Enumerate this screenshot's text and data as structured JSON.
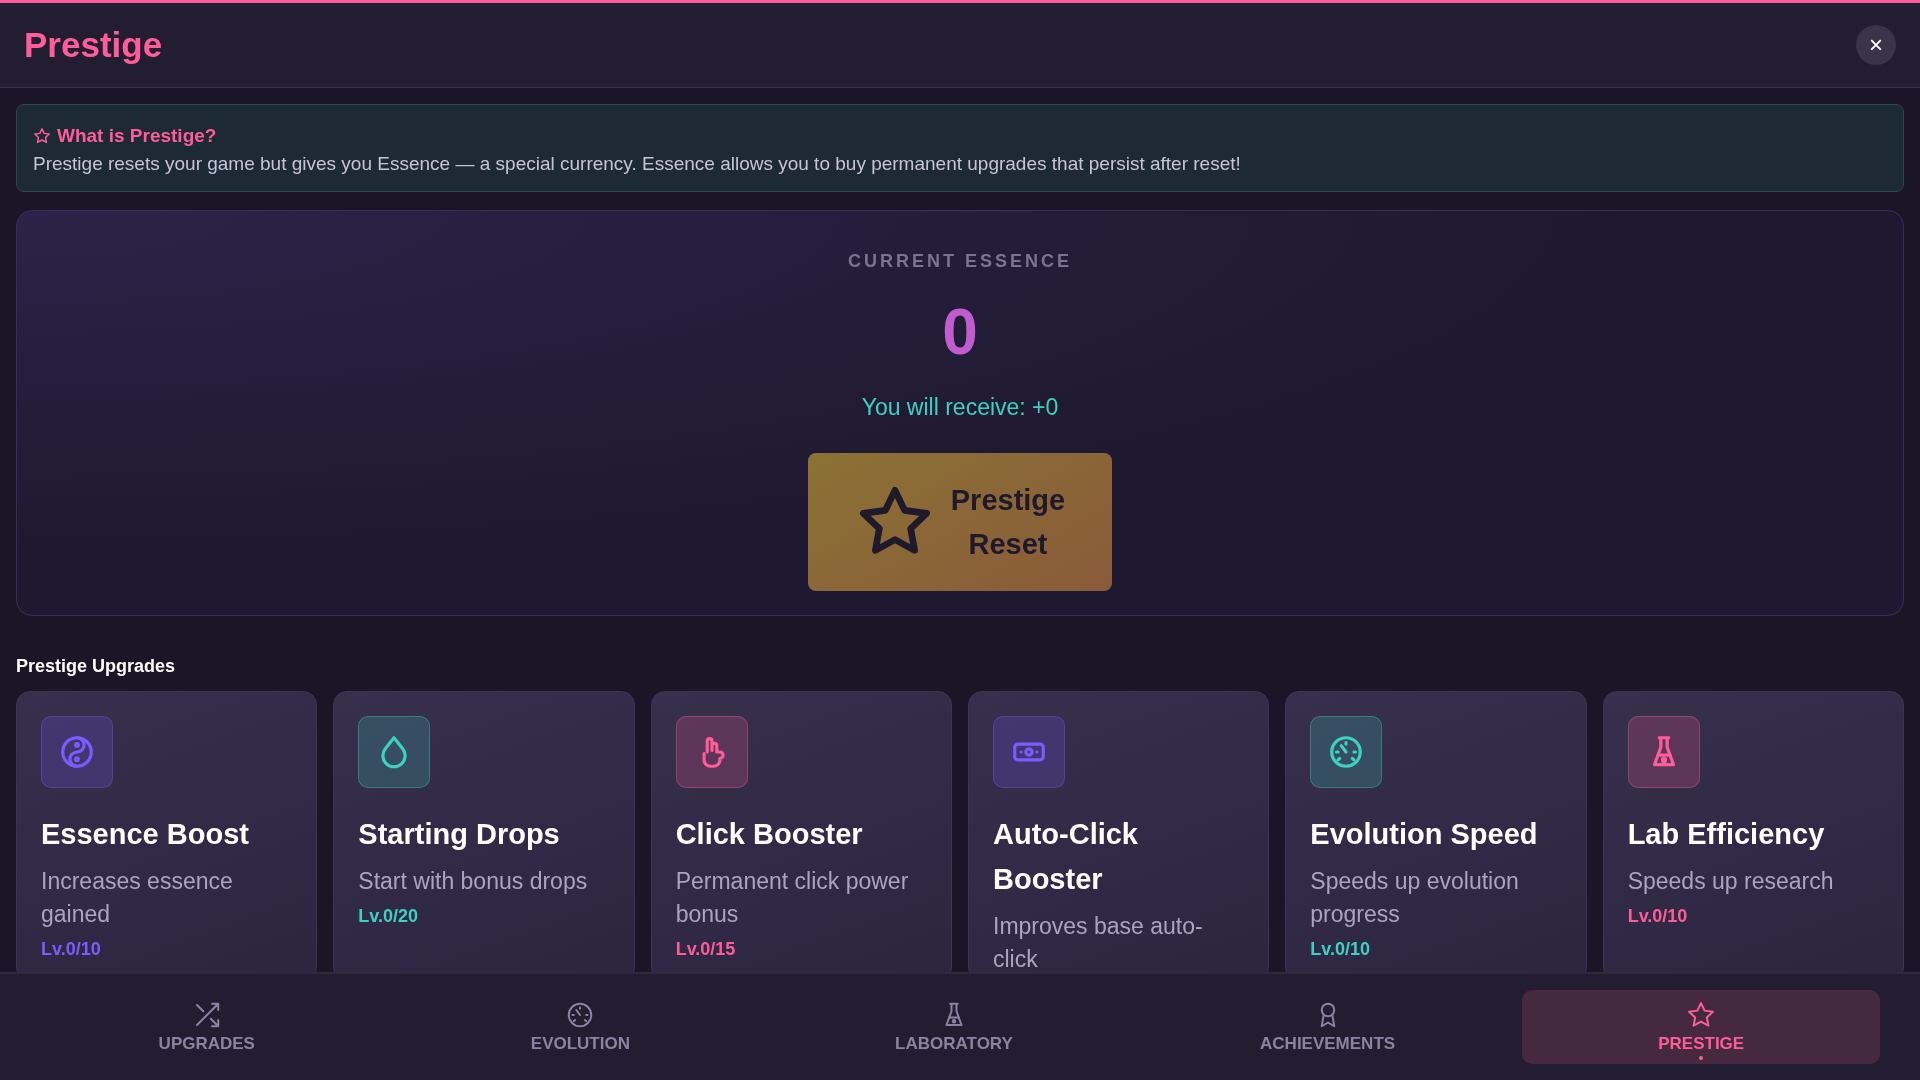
{
  "header": {
    "title": "Prestige",
    "close": "×"
  },
  "info": {
    "title": "What is Prestige?",
    "text": "Prestige resets your game but gives you Essence — a special currency. Essence allows you to buy permanent upgrades that persist after reset!"
  },
  "essence": {
    "label": "CURRENT ESSENCE",
    "value": "0",
    "receive": "You will receive: +0",
    "button": {
      "line_1": "Prestige",
      "line_2": "Reset"
    }
  },
  "upgrades": {
    "heading": "Prestige Upgrades",
    "cards": [
      {
        "color": "#7c5cff",
        "title": "Essence Boost",
        "description": "Increases essence gained",
        "level": "Lv.0/10"
      },
      {
        "color": "#3fd1c0",
        "title": "Starting Drops",
        "description": "Start with bonus drops",
        "level": "Lv.0/20"
      },
      {
        "color": "#ff5c9a",
        "title": "Click Booster",
        "description": "Permanent click power bonus",
        "level": "Lv.0/15"
      },
      {
        "color": "#7c5cff",
        "title": "Auto-Click Booster",
        "description": "Improves base auto-click"
      },
      {
        "color": "#3fd1c0",
        "title": "Evolution Speed",
        "description": "Speeds up evolution progress",
        "level": "Lv.0/10"
      },
      {
        "color": "#ff5c9a",
        "title": "Lab Efficiency",
        "description": "Speeds up research",
        "level": "Lv.0/10"
      }
    ]
  },
  "nav": [
    {
      "label": "UPGRADES",
      "selected": false
    },
    {
      "label": "EVOLUTION",
      "selected": false
    },
    {
      "label": "LABORATORY",
      "selected": false
    },
    {
      "label": "ACHIEVEMENTS",
      "selected": false
    },
    {
      "label": "PRESTIGE",
      "selected": true
    }
  ]
}
